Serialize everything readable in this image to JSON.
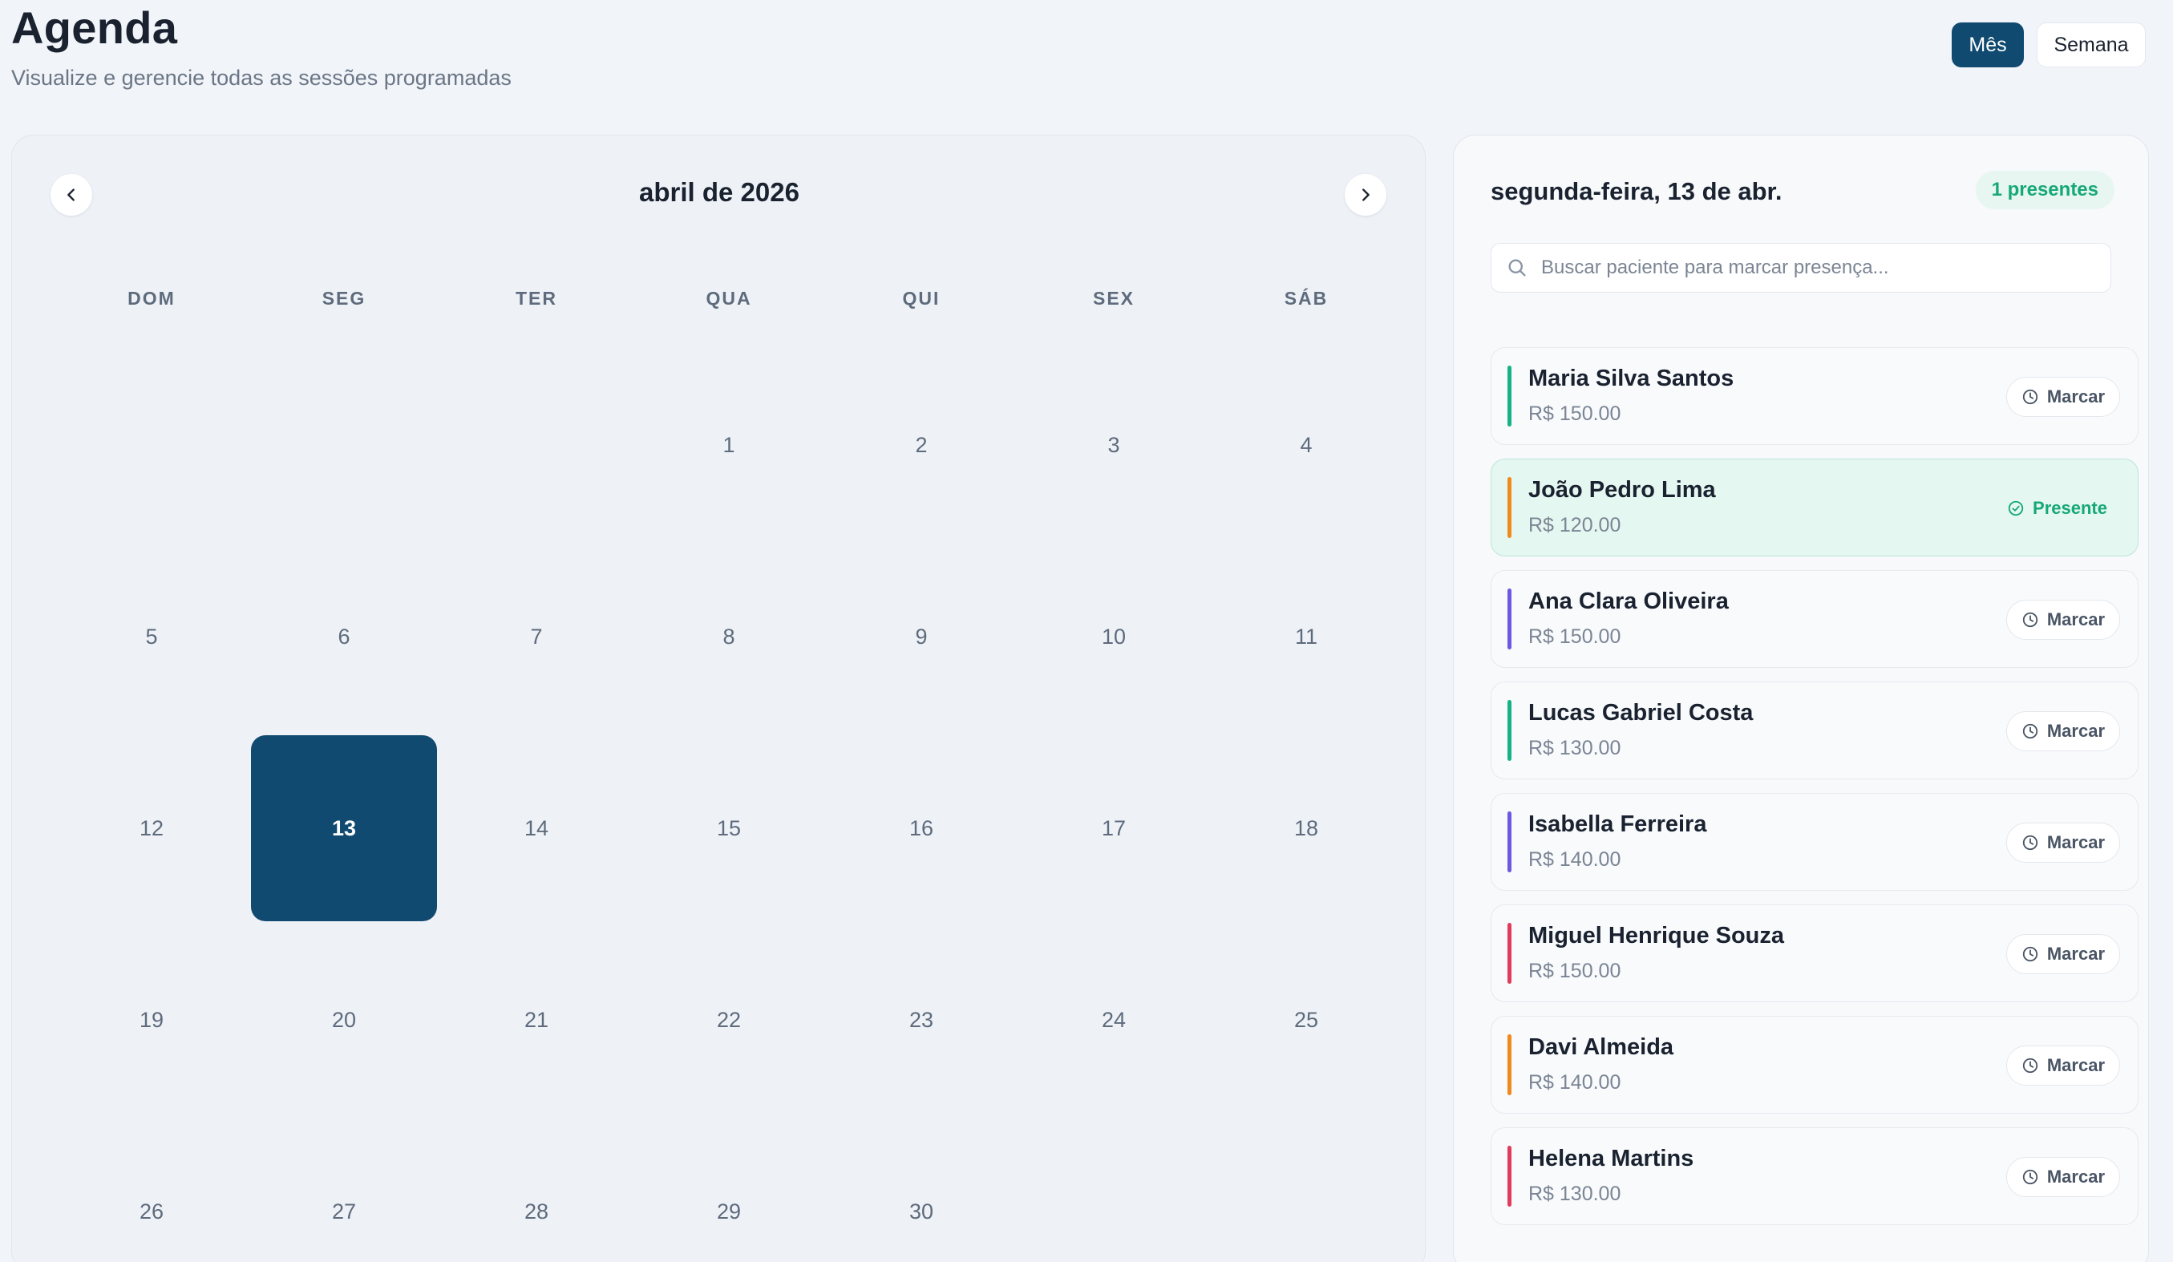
{
  "header": {
    "title": "Agenda",
    "subtitle": "Visualize e gerencie todas as sessões programadas",
    "view_month_label": "Mês",
    "view_week_label": "Semana"
  },
  "calendar": {
    "month_title": "abril de 2026",
    "weekdays": [
      "DOM",
      "SEG",
      "TER",
      "QUA",
      "QUI",
      "SEX",
      "SÁB"
    ],
    "first_weekday_index": 3,
    "days_in_month": 30,
    "selected_day": 13,
    "prev_icon": "chevron-left-icon",
    "next_icon": "chevron-right-icon"
  },
  "sessions": {
    "date_label": "segunda-feira, 13 de abr.",
    "present_badge": "1 presentes",
    "search_placeholder": "Buscar paciente para marcar presença...",
    "mark_label": "Marcar",
    "present_label": "Presente",
    "items": [
      {
        "name": "Maria Silva Santos",
        "price": "R$ 150.00",
        "color": "#16b386",
        "status": "mark"
      },
      {
        "name": "João Pedro Lima",
        "price": "R$ 120.00",
        "color": "#f08a1c",
        "status": "present"
      },
      {
        "name": "Ana Clara Oliveira",
        "price": "R$ 150.00",
        "color": "#6a5ae0",
        "status": "mark"
      },
      {
        "name": "Lucas Gabriel Costa",
        "price": "R$ 130.00",
        "color": "#16b386",
        "status": "mark"
      },
      {
        "name": "Isabella Ferreira",
        "price": "R$ 140.00",
        "color": "#6a5ae0",
        "status": "mark"
      },
      {
        "name": "Miguel Henrique Souza",
        "price": "R$ 150.00",
        "color": "#e23c5c",
        "status": "mark"
      },
      {
        "name": "Davi Almeida",
        "price": "R$ 140.00",
        "color": "#f08a1c",
        "status": "mark"
      },
      {
        "name": "Helena Martins",
        "price": "R$ 130.00",
        "color": "#e23c5c",
        "status": "mark"
      }
    ]
  },
  "colors": {
    "primary": "#104a70",
    "success": "#17a877",
    "background": "#f1f4f8"
  }
}
